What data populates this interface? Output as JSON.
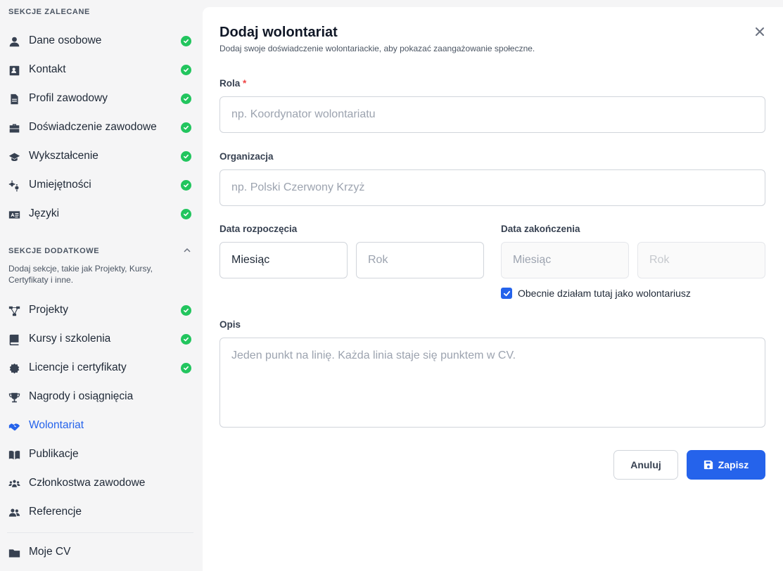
{
  "sidebar": {
    "recommended_title": "SEKCJE ZALECANE",
    "recommended": [
      {
        "label": "Dane osobowe",
        "icon": "user-icon",
        "done": true
      },
      {
        "label": "Kontakt",
        "icon": "contact-card-icon",
        "done": true
      },
      {
        "label": "Profil zawodowy",
        "icon": "document-icon",
        "done": true
      },
      {
        "label": "Doświadczenie zawodowe",
        "icon": "briefcase-icon",
        "done": true
      },
      {
        "label": "Wykształcenie",
        "icon": "graduation-cap-icon",
        "done": true
      },
      {
        "label": "Umiejętności",
        "icon": "gears-icon",
        "done": true
      },
      {
        "label": "Języki",
        "icon": "language-icon",
        "done": true
      }
    ],
    "additional_title": "SEKCJE DODATKOWE",
    "additional_desc": "Dodaj sekcje, takie jak Projekty, Kursy, Certyfikaty i inne.",
    "additional": [
      {
        "label": "Projekty",
        "icon": "diagram-icon",
        "done": true
      },
      {
        "label": "Kursy i szkolenia",
        "icon": "book-icon",
        "done": true
      },
      {
        "label": "Licencje i certyfikaty",
        "icon": "certificate-icon",
        "done": true
      },
      {
        "label": "Nagrody i osiągnięcia",
        "icon": "trophy-icon",
        "done": false
      },
      {
        "label": "Wolontariat",
        "icon": "handshake-icon",
        "done": false,
        "active": true
      },
      {
        "label": "Publikacje",
        "icon": "open-book-icon",
        "done": false
      },
      {
        "label": "Członkostwa zawodowe",
        "icon": "people-group-icon",
        "done": false
      },
      {
        "label": "Referencje",
        "icon": "users-icon",
        "done": false
      }
    ],
    "bottom": {
      "label": "Moje CV",
      "icon": "folder-icon"
    }
  },
  "form": {
    "title": "Dodaj wolontariat",
    "subtitle": "Dodaj swoje doświadczenie wolontariackie, aby pokazać zaangażowanie społeczne.",
    "role_label": "Rola",
    "role_required": "*",
    "role_placeholder": "np. Koordynator wolontariatu",
    "org_label": "Organizacja",
    "org_placeholder": "np. Polski Czerwony Krzyż",
    "start_label": "Data rozpoczęcia",
    "start_month": "Miesiąc",
    "start_year": "Rok",
    "end_label": "Data zakończenia",
    "end_month": "Miesiąc",
    "end_year": "Rok",
    "current_label": "Obecnie działam tutaj jako wolontariusz",
    "current_checked": true,
    "desc_label": "Opis",
    "desc_placeholder": "Jeden punkt na linię. Każda linia staje się punktem w CV.",
    "cancel_label": "Anuluj",
    "save_label": "Zapisz"
  },
  "colors": {
    "accent": "#2563eb",
    "success": "#22c55e",
    "required": "#ef4444"
  }
}
